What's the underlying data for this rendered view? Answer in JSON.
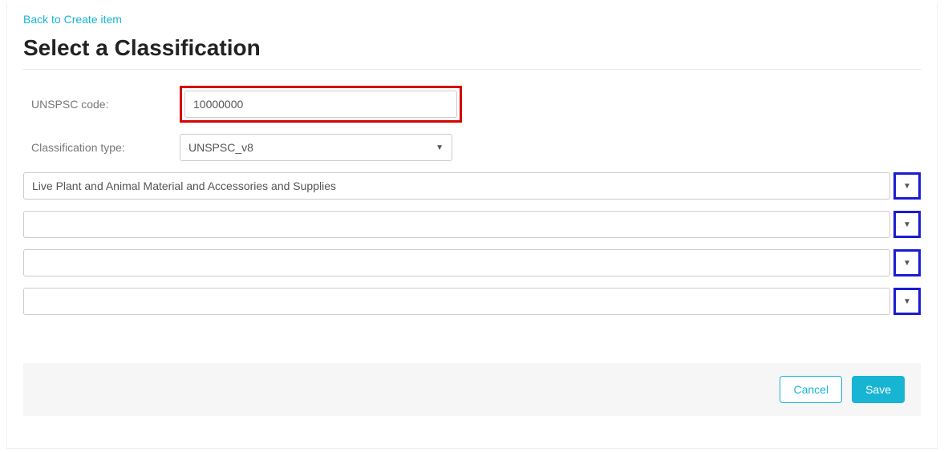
{
  "back_link": "Back to Create item",
  "page_title": "Select a Classification",
  "form": {
    "code_label": "UNSPSC code:",
    "code_value": "10000000",
    "type_label": "Classification type:",
    "type_value": "UNSPSC_v8"
  },
  "levels": [
    {
      "value": "Live Plant and Animal Material and Accessories and Supplies"
    },
    {
      "value": ""
    },
    {
      "value": ""
    },
    {
      "value": ""
    }
  ],
  "buttons": {
    "cancel": "Cancel",
    "save": "Save"
  },
  "icons": {
    "caret": "▼"
  }
}
